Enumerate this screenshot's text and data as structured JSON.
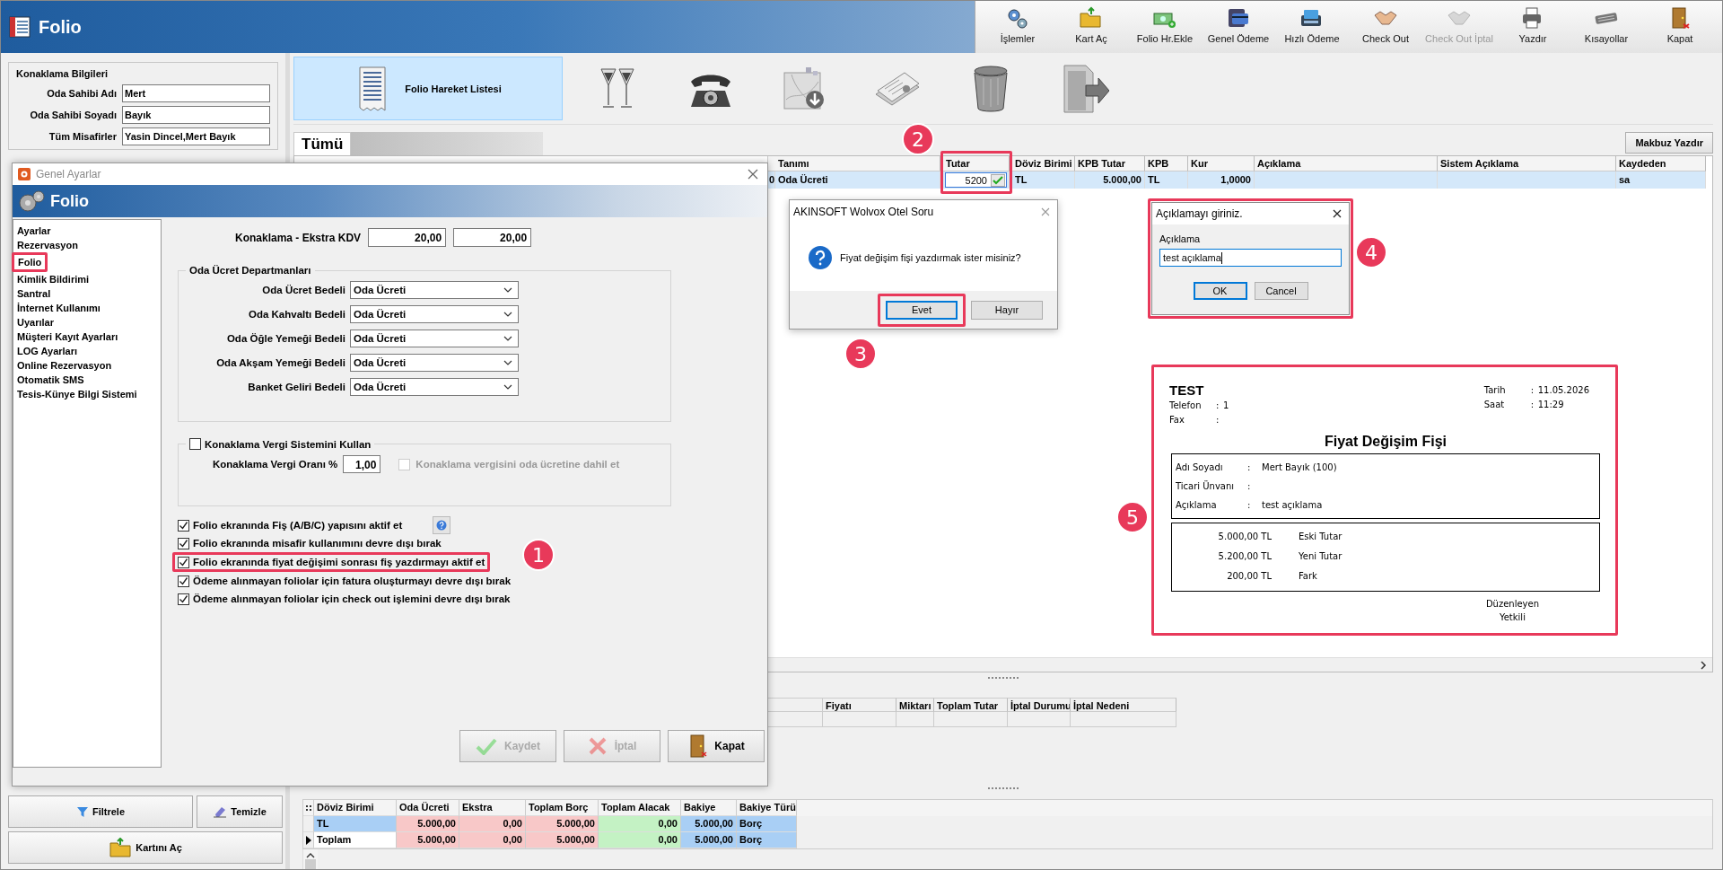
{
  "app": {
    "title": "Folio"
  },
  "toolbar": [
    {
      "label": "İşlemler",
      "disabled": false
    },
    {
      "label": "Kart Aç",
      "disabled": false
    },
    {
      "label": "Folio Hr.Ekle",
      "disabled": false
    },
    {
      "label": "Genel Ödeme",
      "disabled": false
    },
    {
      "label": "Hızlı Ödeme",
      "disabled": false
    },
    {
      "label": "Check Out",
      "disabled": false
    },
    {
      "label": "Check Out İptal",
      "disabled": true
    },
    {
      "label": "Yazdır",
      "disabled": false
    },
    {
      "label": "Kısayollar",
      "disabled": false
    },
    {
      "label": "Kapat",
      "disabled": false
    }
  ],
  "stay_info": {
    "title": "Konaklama Bilgileri",
    "fields": [
      {
        "label": "Oda Sahibi Adı",
        "value": "Mert"
      },
      {
        "label": "Oda Sahibi Soyadı",
        "value": "Bayık"
      },
      {
        "label": "Tüm Misafirler",
        "value": "Yasin Dincel,Mert Bayık"
      }
    ]
  },
  "left_buttons": [
    {
      "label": "Filtrele"
    },
    {
      "label": "Temizle"
    },
    {
      "label": "Kartını Aç"
    }
  ],
  "views": [
    {
      "label": "Folio Hareket Listesi",
      "selected": true
    },
    {
      "selected": false
    },
    {
      "selected": false
    },
    {
      "selected": false
    },
    {
      "selected": false
    },
    {
      "selected": false
    },
    {
      "selected": false
    }
  ],
  "tabs": [
    {
      "label": "Tümü",
      "selected": true
    }
  ],
  "print_button": "Makbuz Yazdır",
  "movements_grid": {
    "columns": [
      "Tanımı",
      "Tutar",
      "Döviz Birimi",
      "KPB Tutar",
      "KPB",
      "Kur",
      "Açıklama",
      "Sistem Açıklama",
      "Kaydeden"
    ],
    "rows": [
      {
        "selected": true,
        "partial_cell": "0",
        "cells": [
          {
            "kind": "text",
            "value": "Oda Ücreti"
          },
          {
            "kind": "editor",
            "value": "5200"
          },
          {
            "kind": "text",
            "value": "TL"
          },
          {
            "kind": "text",
            "value": "5.000,00"
          },
          {
            "kind": "text",
            "value": "TL"
          },
          {
            "kind": "text",
            "value": "1,0000"
          },
          {
            "kind": "text"
          },
          {
            "kind": "text"
          },
          {
            "kind": "text",
            "value": "sa"
          }
        ]
      }
    ]
  },
  "details_grid": {
    "columns": [
      "Fiyatı",
      "Miktarı",
      "Toplam Tutar",
      "İptal Durumu",
      "İptal Nedeni"
    ]
  },
  "totals_grid": {
    "columns": [
      "Döviz Birimi",
      "Oda Ücreti",
      "Ekstra",
      "Toplam Borç",
      "Toplam Alacak",
      "Bakiye",
      "Bakiye Türü"
    ],
    "rows": [
      {
        "current": false,
        "cells": [
          "TL",
          "5.000,00",
          "0,00",
          "5.000,00",
          "0,00",
          "5.000,00",
          "Borç"
        ]
      },
      {
        "current": true,
        "cells": [
          "Toplam",
          "5.000,00",
          "0,00",
          "5.000,00",
          "0,00",
          "5.000,00",
          "Borç"
        ]
      }
    ]
  },
  "settings_dialog": {
    "title": "Genel Ayarlar",
    "header": "Folio",
    "nav": [
      {
        "label": "Ayarlar",
        "selected": false
      },
      {
        "label": "Rezervasyon",
        "selected": false
      },
      {
        "label": "Folio",
        "selected": true
      },
      {
        "label": "Kimlik Bildirimi",
        "selected": false
      },
      {
        "label": "Santral",
        "selected": false
      },
      {
        "label": "İnternet Kullanımı",
        "selected": false
      },
      {
        "label": "Uyarılar",
        "selected": false
      },
      {
        "label": "Müşteri Kayıt Ayarları",
        "selected": false
      },
      {
        "label": "LOG Ayarları",
        "selected": false
      },
      {
        "label": "Online Rezervasyon",
        "selected": false
      },
      {
        "label": "Otomatik SMS",
        "selected": false
      },
      {
        "label": "Tesis-Künye Bilgi Sistemi",
        "selected": false
      }
    ],
    "vat": {
      "label": "Konaklama  - Ekstra KDV",
      "values": [
        "20,00",
        "20,00"
      ]
    },
    "departments": {
      "title": "Oda Ücret Departmanları",
      "rows": [
        {
          "label": "Oda Ücret Bedeli",
          "value": "Oda Ücreti"
        },
        {
          "label": "Oda Kahvaltı Bedeli",
          "value": "Oda Ücreti"
        },
        {
          "label": "Oda Öğle Yemeği Bedeli",
          "value": "Oda Ücreti"
        },
        {
          "label": "Oda Akşam Yemeği Bedeli",
          "value": "Oda Ücreti"
        },
        {
          "label": "Banket Geliri Bedeli",
          "value": "Oda Ücreti"
        }
      ]
    },
    "tax": {
      "label": "Konaklama Vergi Sistemini Kullan",
      "checked": false,
      "rate_label": "Konaklama Vergi Oranı %",
      "rate": "1,00",
      "include": {
        "label": "Konaklama vergisini oda ücretine dahil et",
        "checked": false,
        "disabled": true
      }
    },
    "options": [
      {
        "label": "Folio ekranında Fiş (A/B/C) yapısını aktif et",
        "checked": true,
        "help": true
      },
      {
        "label": "Folio ekranında misafir kullanımını devre dışı bırak",
        "checked": true,
        "help": false
      },
      {
        "label": "Folio ekranında fiyat değişimi sonrası fiş yazdırmayı aktif et",
        "checked": true,
        "help": false
      },
      {
        "label": "Ödeme alınmayan foliolar için fatura oluşturmayı devre dışı bırak",
        "checked": true,
        "help": false
      },
      {
        "label": "Ödeme alınmayan foliolar için check out işlemini devre dışı bırak",
        "checked": true,
        "help": false
      }
    ],
    "buttons": [
      {
        "label": "Kaydet",
        "disabled": true
      },
      {
        "label": "İptal",
        "disabled": true
      },
      {
        "label": "Kapat",
        "disabled": false
      }
    ]
  },
  "question_dialog": {
    "title": "AKINSOFT Wolvox Otel Soru",
    "message": "Fiyat değişim fişi yazdırmak ister misiniz?",
    "buttons": [
      {
        "label": "Evet",
        "default": true
      },
      {
        "label": "Hayır",
        "default": false
      }
    ]
  },
  "note_dialog": {
    "title": "Açıklamayı giriniz.",
    "field_label": "Açıklama",
    "value": "test açıklama",
    "buttons": [
      {
        "label": "OK",
        "default": true
      },
      {
        "label": "Cancel",
        "default": false
      }
    ]
  },
  "receipt": {
    "company": "TEST",
    "contacts": [
      {
        "label": "Telefon",
        "sep": ":",
        "value": "1"
      },
      {
        "label": "Fax",
        "sep": ":"
      }
    ],
    "stamp": [
      {
        "label": "Tarih",
        "sep": ":",
        "value": "11.05.2026"
      },
      {
        "label": "Saat",
        "sep": ":",
        "value": "11:29"
      }
    ],
    "title": "Fiyat Değişim Fişi",
    "details": [
      {
        "label": "Adı Soyadı",
        "sep": ":",
        "value": "Mert Bayık (100)"
      },
      {
        "label": "Ticari Ünvanı",
        "sep": ":"
      },
      {
        "label": "Açıklama",
        "sep": ":",
        "value": "test açıklama"
      }
    ],
    "amounts": [
      {
        "value": "5.000,00 TL",
        "label": "Eski Tutar"
      },
      {
        "value": "5.200,00 TL",
        "label": "Yeni Tutar"
      },
      {
        "value": "200,00 TL",
        "label": "Fark"
      }
    ],
    "signature": [
      "Düzenleyen",
      "Yetkili"
    ]
  },
  "markers": [
    "1",
    "2",
    "3",
    "4",
    "5"
  ]
}
